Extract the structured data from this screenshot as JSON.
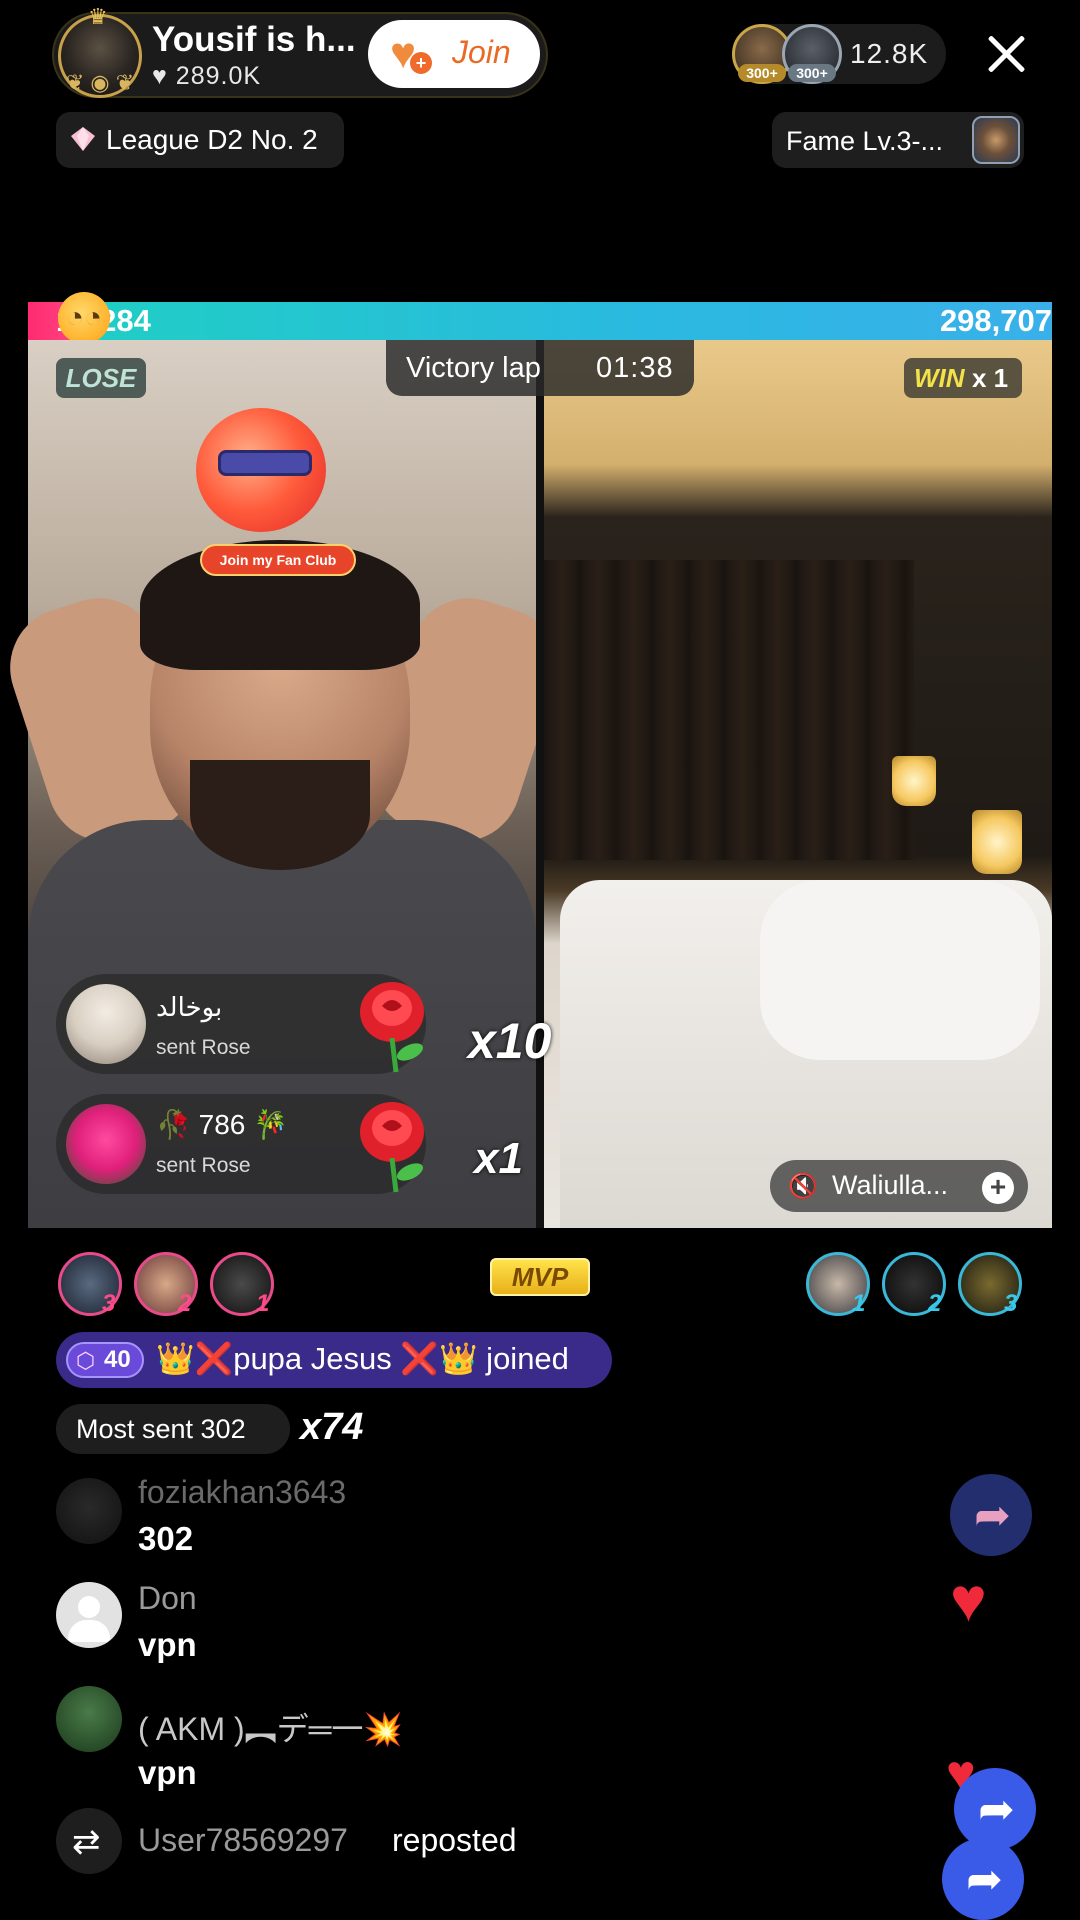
{
  "host": {
    "name": "Yousif is h...",
    "likes": "289.0K",
    "join_label": "Join",
    "league": "League D2 No. 2",
    "fame": "Fame Lv.3-..."
  },
  "viewers": {
    "badge_1": "300+",
    "badge_2": "300+",
    "count": "12.8K"
  },
  "battle": {
    "left_score": "17,284",
    "right_score": "298,707",
    "left_fraction": 0.055,
    "timer_label": "Victory lap",
    "timer_value": "01:38",
    "lose_label": "LOSE",
    "win_label": "WIN",
    "win_mult": "x 1",
    "fanclub_label": "Join my Fan Club",
    "guest_name": "Waliulla...",
    "mvp_label": "MVP",
    "left_ranks": [
      "3",
      "2",
      "1"
    ],
    "right_ranks": [
      "1",
      "2",
      "3"
    ]
  },
  "gifts": [
    {
      "user": "بوخالد",
      "action": "sent Rose",
      "count": "x10"
    },
    {
      "user": "🥀 786 🎋",
      "action": "sent Rose",
      "count": "x1"
    }
  ],
  "chat": {
    "joined_level": "40",
    "joined_text": "👑❌pupa Jesus ❌👑 joined",
    "most_sent_label": "Most sent 302",
    "most_sent_mult": "x74",
    "messages": [
      {
        "user": "foziakhan3643",
        "text": "302"
      },
      {
        "user": "Don",
        "text": "vpn"
      },
      {
        "user": "( AKM )︻デ═一💥",
        "text": "vpn"
      }
    ],
    "repost_user": "User78569297",
    "repost_action": "reposted"
  },
  "icons": {
    "close": "close-icon",
    "heart": "heart-icon",
    "share": "share-icon",
    "repost": "repost-icon",
    "mute": "muted-speaker-icon",
    "diamond": "diamond-icon"
  },
  "colors": {
    "pink_team": "#ff2a72",
    "blue_team": "#2ab9e0",
    "join_orange": "#e96a24",
    "joined_purple": "#3a2a8a",
    "mvp_gold": "#ffe24a"
  }
}
